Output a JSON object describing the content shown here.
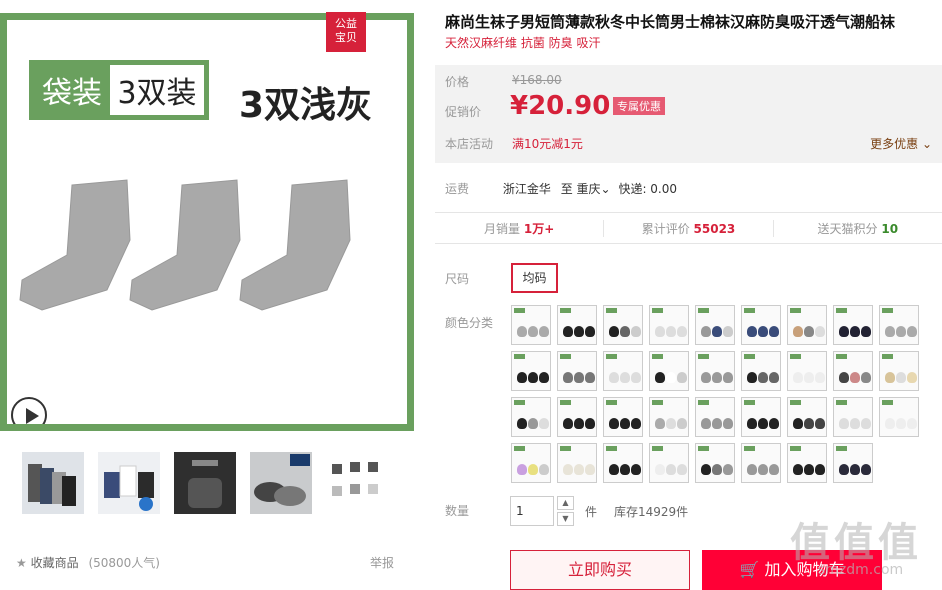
{
  "image": {
    "badge": [
      "公益",
      "宝贝"
    ],
    "pack_label_left": "袋装",
    "pack_label_right": "3双装",
    "color_title": "3双浅灰"
  },
  "favorites": {
    "label": "收藏商品",
    "count": "(50800人气)",
    "report": "举报"
  },
  "product": {
    "title": "麻尚生袜子男短筒薄款秋冬中长筒男士棉袜汉麻防臭吸汗透气潮船袜",
    "subtitle": "天然汉麻纤维 抗菌 防臭 吸汗"
  },
  "price": {
    "label_price": "价格",
    "original": "¥168.00",
    "label_promo": "促销价",
    "promo": "¥20.90",
    "promo_badge": "专属优惠",
    "label_activity": "本店活动",
    "activity": "满10元减1元",
    "more": "更多优惠"
  },
  "shipping": {
    "label": "运费",
    "from": "浙江金华",
    "to_label": "至",
    "to": "重庆",
    "express": "快递: 0.00"
  },
  "stats": {
    "monthly_label": "月销量",
    "monthly": "1万+",
    "reviews_label": "累计评价",
    "reviews": "55023",
    "points_label": "送天猫积分",
    "points": "10"
  },
  "size": {
    "label": "尺码",
    "value": "均码"
  },
  "color": {
    "label": "颜色分类"
  },
  "quantity": {
    "label": "数量",
    "value": "1",
    "unit": "件",
    "stock": "库存14929件"
  },
  "buttons": {
    "buy_now": "立即购买",
    "add_cart": "加入购物车"
  },
  "watermark": {
    "text": "值值值",
    "url": "smzdm.com"
  },
  "colors": {
    "accent": "#d6213a",
    "green_frame": "#6aa05e",
    "cart_red": "#ff0036"
  }
}
